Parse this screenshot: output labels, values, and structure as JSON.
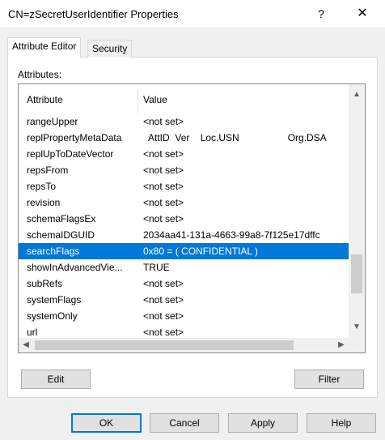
{
  "window": {
    "title": "CN=zSecretUserIdentifier Properties",
    "help_glyph": "?",
    "close_glyph": "✕"
  },
  "tabs": [
    {
      "label": "Attribute Editor",
      "active": true
    },
    {
      "label": "Security",
      "active": false
    }
  ],
  "attributes_label": "Attributes:",
  "columns": {
    "attribute": "Attribute",
    "value": "Value"
  },
  "rows": [
    {
      "name": "rangeUpper",
      "value": "<not set>"
    },
    {
      "name": "replPropertyMetaData",
      "value": "  AttID  Ver    Loc.USN                  Org.DSA"
    },
    {
      "name": "replUpToDateVector",
      "value": "<not set>"
    },
    {
      "name": "repsFrom",
      "value": "<not set>"
    },
    {
      "name": "repsTo",
      "value": "<not set>"
    },
    {
      "name": "revision",
      "value": "<not set>"
    },
    {
      "name": "schemaFlagsEx",
      "value": "<not set>"
    },
    {
      "name": "schemaIDGUID",
      "value": "2034aa41-131a-4663-99a8-7f125e17dffc"
    },
    {
      "name": "searchFlags",
      "value": "0x80 = ( CONFIDENTIAL )",
      "selected": true
    },
    {
      "name": "showInAdvancedVie...",
      "value": "TRUE"
    },
    {
      "name": "subRefs",
      "value": "<not set>"
    },
    {
      "name": "systemFlags",
      "value": "<not set>"
    },
    {
      "name": "systemOnly",
      "value": "<not set>"
    },
    {
      "name": "url",
      "value": "<not set>"
    }
  ],
  "buttons": {
    "edit": "Edit",
    "filter": "Filter",
    "ok": "OK",
    "cancel": "Cancel",
    "apply": "Apply",
    "help": "Help"
  },
  "colors": {
    "selection": "#0078d7",
    "dialog_bg": "#f0f0f0"
  }
}
